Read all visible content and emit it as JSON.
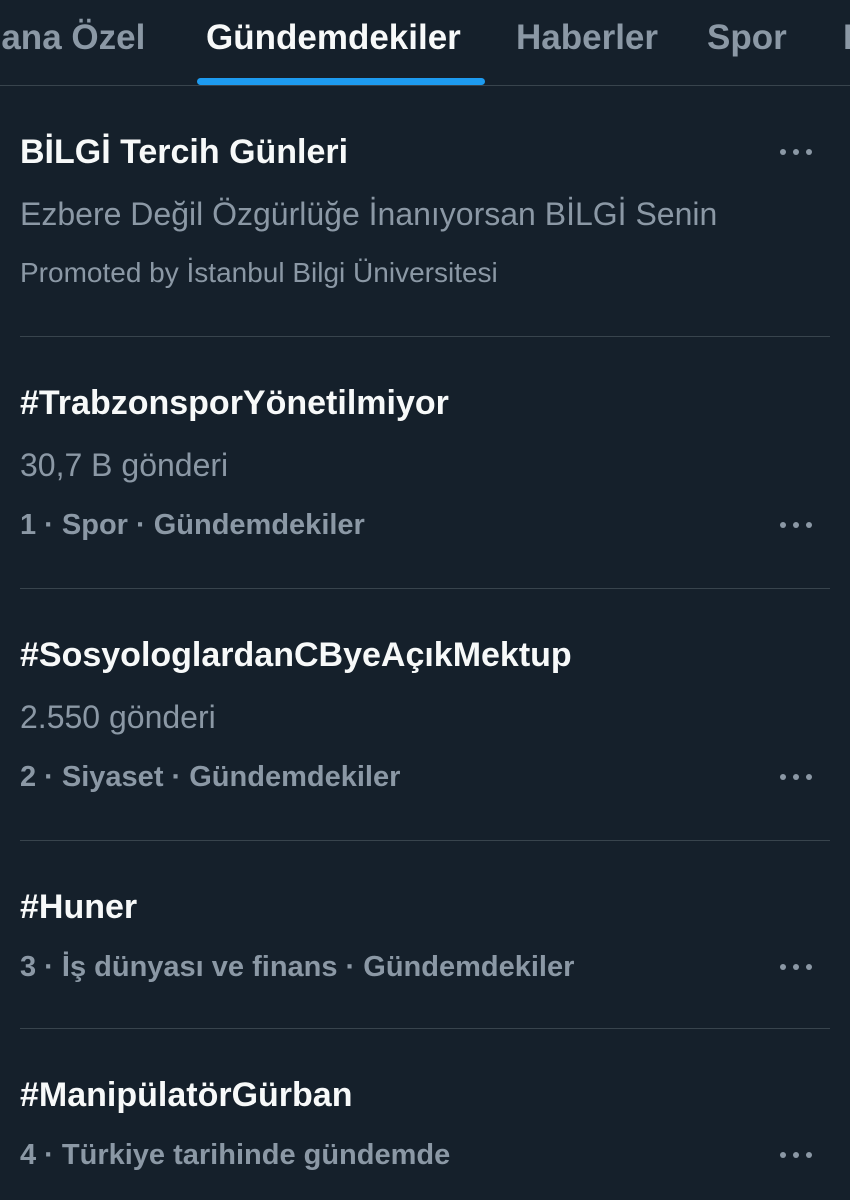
{
  "tabs": [
    {
      "label": "Sana Özel"
    },
    {
      "label": "Gündemdekiler"
    },
    {
      "label": "Haberler"
    },
    {
      "label": "Spor"
    },
    {
      "label": "E"
    }
  ],
  "promoted": {
    "title": "BİLGİ Tercih Günleri",
    "description": "Ezbere Değil Özgürlüğe İnanıyorsan BİLGİ Senin",
    "promoted_by": "Promoted by İstanbul Bilgi Üniversitesi"
  },
  "trends": [
    {
      "title": "#TrabzonsporYönetilmiyor",
      "count": "30,7 B gönderi",
      "meta": "1 · Spor · Gündemdekiler"
    },
    {
      "title": "#SosyologlardanCByeAçıkMektup",
      "count": "2.550 gönderi",
      "meta": "2 · Siyaset · Gündemdekiler"
    },
    {
      "title": "#Huner",
      "meta": "3 · İş dünyası ve finans · Gündemdekiler"
    },
    {
      "title": "#ManipülatörGürban",
      "meta": "4 · Türkiye tarihinde gündemde"
    }
  ],
  "icons": {
    "more": "more-options-icon"
  },
  "colors": {
    "background": "#15202b",
    "accent": "#1d9bf0",
    "text_primary": "#f7f9f9",
    "text_secondary": "#8b98a5",
    "divider": "#38444d"
  }
}
